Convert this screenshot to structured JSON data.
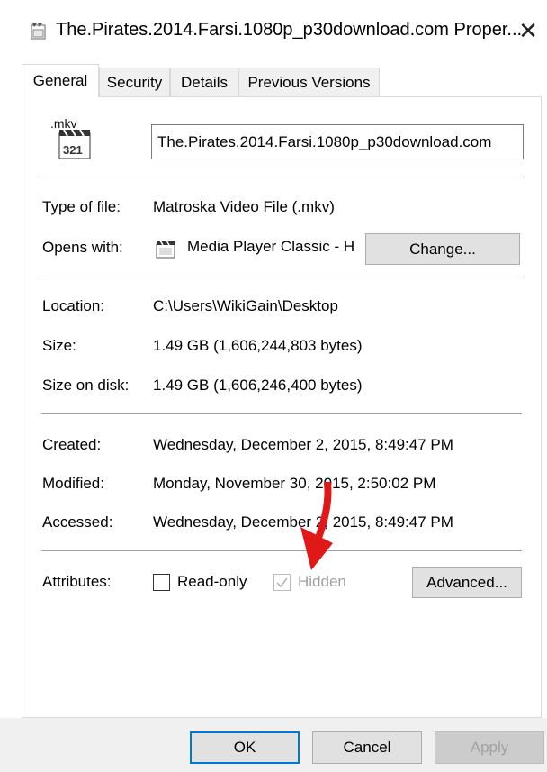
{
  "window": {
    "title": "The.Pirates.2014.Farsi.1080p_p30download.com Proper...",
    "close_glyph": "✕"
  },
  "tabs": [
    {
      "label": "General",
      "active": true
    },
    {
      "label": "Security"
    },
    {
      "label": "Details"
    },
    {
      "label": "Previous Versions"
    }
  ],
  "file": {
    "icon_ext": ".mkv",
    "icon_num": "321",
    "name": "The.Pirates.2014.Farsi.1080p_p30download.com"
  },
  "type_of_file": {
    "label": "Type of file:",
    "value": "Matroska Video File (.mkv)"
  },
  "opens_with": {
    "label": "Opens with:",
    "value": "Media Player Classic - H",
    "change_label": "Change..."
  },
  "location": {
    "label": "Location:",
    "value": "C:\\Users\\WikiGain\\Desktop"
  },
  "size": {
    "label": "Size:",
    "value": "1.49 GB (1,606,244,803 bytes)"
  },
  "size_on_disk": {
    "label": "Size on disk:",
    "value": "1.49 GB (1,606,246,400 bytes)"
  },
  "created": {
    "label": "Created:",
    "value": "Wednesday, December 2, 2015, 8:49:47 PM"
  },
  "modified": {
    "label": "Modified:",
    "value": "Monday, November 30, 2015, 2:50:02 PM"
  },
  "accessed": {
    "label": "Accessed:",
    "value": "Wednesday, December 2, 2015, 8:49:47 PM"
  },
  "attributes": {
    "label": "Attributes:",
    "readonly_label": "Read-only",
    "readonly_checked": false,
    "hidden_label": "Hidden",
    "hidden_checked": true,
    "hidden_disabled": true,
    "advanced_label": "Advanced..."
  },
  "footer": {
    "ok_label": "OK",
    "cancel_label": "Cancel",
    "apply_label": "Apply"
  },
  "colors": {
    "accent": "#0078d7",
    "annotation_arrow": "#e01818",
    "footer_bg": "#f0f0f0"
  }
}
